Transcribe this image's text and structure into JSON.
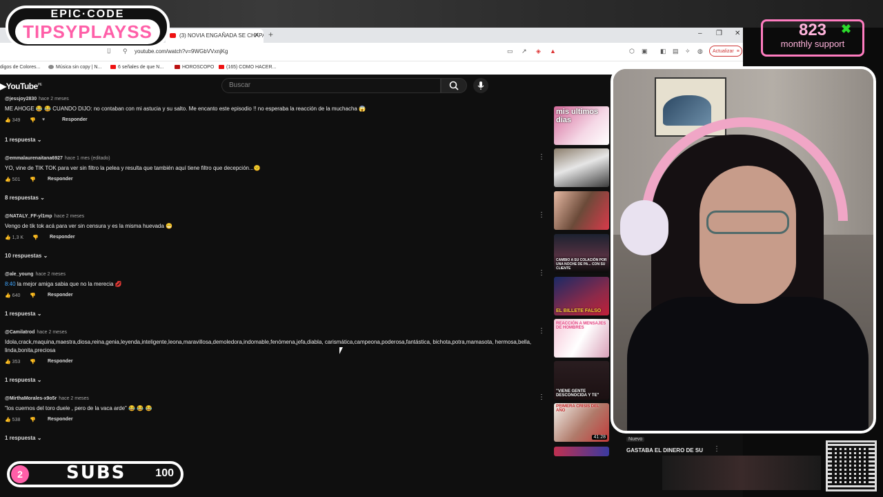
{
  "browser": {
    "tab_title": "(3) NOVIA ENGAÑADA SE CHAPA...",
    "url": "youtube.com/watch?v=9WGbVVxnjKg",
    "update_label": "Actualizar",
    "bookmarks": [
      "digos de Colores...",
      "Música sin copy | N...",
      "6 señales de que N...",
      "HOROSCOPO",
      "(165) COMO HACER..."
    ]
  },
  "youtube": {
    "logo": "YouTube",
    "region": "PE",
    "search_placeholder": "Buscar",
    "comments": [
      {
        "author": "@jessjoy2830",
        "time": "hace 2 meses",
        "text": "ME AHOGE 😂 😂 CUANDO DIJO: no contaban con mi astucia y su salto. Me encanto este episodio !! no esperaba la reacción de la muchacha 😱",
        "likes": "349",
        "reply": "Responder",
        "replies": "1 respuesta"
      },
      {
        "author": "@emmalaurenaitana6927",
        "time": "hace 1 mes (editado)",
        "text": "YO, vine de TIK TOK para ver sin filtro la pelea y resulta que también aquí tiene filtro que decepción...😕",
        "likes": "501",
        "reply": "Responder",
        "replies": "8 respuestas"
      },
      {
        "author": "@NATALY_FF-yl1mp",
        "time": "hace 2 meses",
        "text": "Vengo  de tik tok acá para ver sin censura  y es la misma huevada 😬",
        "likes": "1,3 K",
        "reply": "Responder",
        "replies": "10 respuestas"
      },
      {
        "author": "@ale_young",
        "time": "hace 2 meses",
        "timestamp": "8:40",
        "text": "la mejor amiga sabia que no la merecia 💋",
        "likes": "640",
        "reply": "Responder",
        "replies": "1 respuesta"
      },
      {
        "author": "@Camilatrod",
        "time": "hace 2 meses",
        "text": "Idola,crack,maquina,maestra,diosa,reina,genia,leyenda,inteligente,leona,maravillosa,demoledora,indomable,fenómena,jefa,diabla, carismática,campeona,poderosa,fantástica, bichota,potra,mamasota, hermosa,bella, linda,bonita,preciosa",
        "likes": "353",
        "reply": "Responder",
        "replies": "1 respuesta"
      },
      {
        "author": "@MirthaMorales-x9o5r",
        "time": "hace 2 meses",
        "text": "\"los cuernos del toro duele , pero de la vaca arde\" 😂 😂 😂",
        "likes": "538",
        "reply": "Responder",
        "replies": "1 respuesta"
      }
    ],
    "sidebar": {
      "thumb_texts": [
        "mis ultimos dias",
        "",
        "",
        "CAMBIO A SU COLACIÓN POR UNA NOCHE DE PA... CON SU CLIENTE",
        "EL BILLETE FALSO",
        "REACCIÓN A MENSAJES DE HOMBRES",
        "\"VIENE GENTE DESCONOCIDA Y TE\"",
        "PRIMERA CRISIS DEL AÑO"
      ],
      "duration": "41:28",
      "new_badge": "Nuevo",
      "next_title": "GASTABA EL DINERO DE SU"
    }
  },
  "overlay": {
    "brand_top": "EPIC·CODE",
    "brand_main": "TIPSYPLAYSS",
    "support_count": "823",
    "support_label": "monthly support",
    "subs_current": "2",
    "subs_label": "SUBS",
    "subs_goal": "100"
  },
  "colors": {
    "accent": "#ff5fa8",
    "yt_bg": "#0f0f0f"
  }
}
